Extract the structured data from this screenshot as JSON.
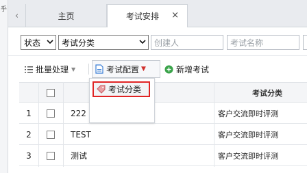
{
  "left_strip": {
    "glyph": "乎"
  },
  "tabs": [
    {
      "label": "主页"
    },
    {
      "label": "考试安排",
      "close": "×"
    }
  ],
  "filters": {
    "status": "状态",
    "category": "考试分类",
    "creator_placeholder": "创建人",
    "name_placeholder": "考试名称"
  },
  "toolbar": {
    "batch": "批量处理",
    "config": "考试配置",
    "add": "新增考试"
  },
  "dropdown": {
    "item": "考试分类"
  },
  "table": {
    "header_category": "考试分类",
    "rows": [
      {
        "num": "1",
        "name": "222",
        "category": "客户交流即时评测"
      },
      {
        "num": "2",
        "name": "TEST",
        "category": "客户交流即时评测"
      },
      {
        "num": "3",
        "name": "测试",
        "category": "客户交流即时评测"
      }
    ]
  },
  "colors": {
    "highlight": "#e02424",
    "add_icon": "#3aa34a"
  }
}
